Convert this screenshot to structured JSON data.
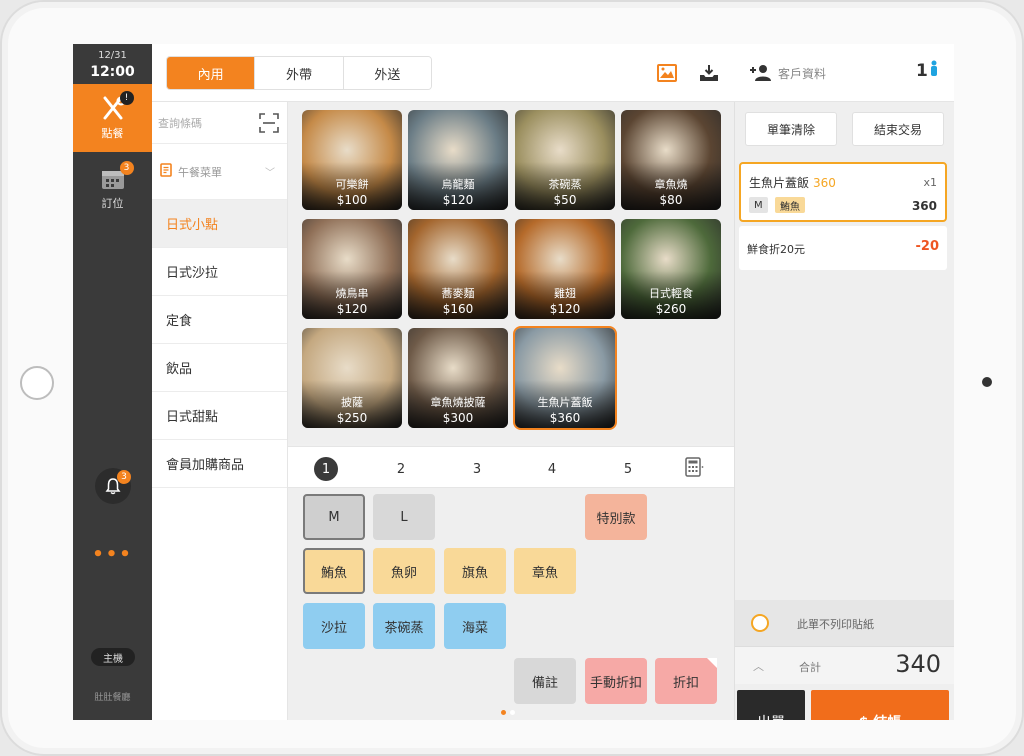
{
  "rail": {
    "date": "12/31",
    "time": "12:00",
    "order_label": "點餐",
    "order_badge": "!",
    "reservation_label": "訂位",
    "reservation_badge": "3",
    "bell_badge": "3",
    "more": "•••",
    "host_label": "主機",
    "shop_name": "肚肚餐廳"
  },
  "header": {
    "tabs": [
      {
        "label": "內用",
        "active": true
      },
      {
        "label": "外帶",
        "active": false
      },
      {
        "label": "外送",
        "active": false
      }
    ],
    "customer_label": "客戶資料",
    "guest_count": "1"
  },
  "categories": {
    "search_placeholder": "查詢條碼",
    "menu_selector": "午餐菜單",
    "items": [
      "日式小點",
      "日式沙拉",
      "定食",
      "飲品",
      "日式甜點",
      "會員加購商品"
    ],
    "active_index": 0
  },
  "products": [
    {
      "name": "可樂餅",
      "price": "$100",
      "bg": "#c58a48"
    },
    {
      "name": "烏龍麵",
      "price": "$120",
      "bg": "#6b7d86"
    },
    {
      "name": "茶碗蒸",
      "price": "$50",
      "bg": "#9b8f5f"
    },
    {
      "name": "章魚燒",
      "price": "$80",
      "bg": "#5b4532"
    },
    {
      "name": "燒鳥串",
      "price": "$120",
      "bg": "#8f6f57"
    },
    {
      "name": "蕎麥麵",
      "price": "$160",
      "bg": "#a3652d"
    },
    {
      "name": "雞翅",
      "price": "$120",
      "bg": "#b56a2a"
    },
    {
      "name": "日式輕食",
      "price": "$260",
      "bg": "#4e6a3b"
    },
    {
      "name": "披薩",
      "price": "$250",
      "bg": "#c4a880"
    },
    {
      "name": "章魚燒披薩",
      "price": "$300",
      "bg": "#6e5a48"
    },
    {
      "name": "生魚片蓋飯",
      "price": "$360",
      "bg": "#8a9aa4",
      "selected": true
    }
  ],
  "pages": {
    "numbers": [
      "1",
      "2",
      "3",
      "4",
      "5"
    ],
    "active": 0
  },
  "modifiers": {
    "size_m": "M",
    "size_l": "L",
    "special": "特別款",
    "fish": [
      "鮪魚",
      "魚卵",
      "旗魚",
      "章魚"
    ],
    "sides": [
      "沙拉",
      "茶碗蒸",
      "海菜"
    ],
    "note": "備註",
    "manual_discount": "手動折扣",
    "discount": "折扣"
  },
  "order": {
    "clear_label": "單筆清除",
    "end_label": "結束交易",
    "item": {
      "name": "生魚片蓋飯",
      "unit_price": "360",
      "qty": "x1",
      "tag_size": "M",
      "tag_fish": "鮪魚",
      "price": "360"
    },
    "discount_label": "鮮食折20元",
    "discount_value": "-20",
    "no_print_label": "此單不列印貼紙",
    "total_label": "合計",
    "total_value": "340",
    "out_label": "出單",
    "pay_label": "$ 結帳"
  },
  "colors": {
    "accent": "#f3831f",
    "pay": "#f16d1b",
    "rail": "#3a3a3a"
  }
}
